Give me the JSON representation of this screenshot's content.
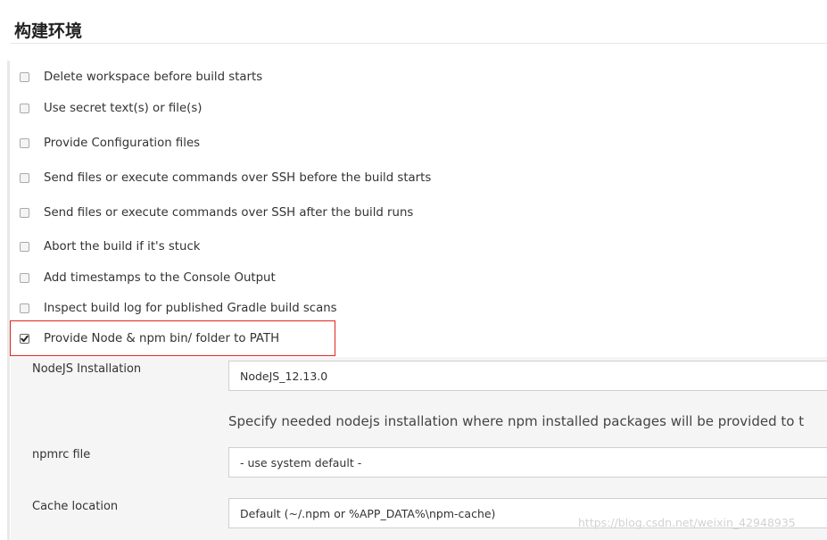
{
  "section": {
    "title": "构建环境"
  },
  "options": [
    {
      "label": "Delete workspace before build starts",
      "checked": false
    },
    {
      "label": "Use secret text(s) or file(s)",
      "checked": false
    },
    {
      "label": "Provide Configuration files",
      "checked": false
    },
    {
      "label": "Send files or execute commands over SSH before the build starts",
      "checked": false
    },
    {
      "label": "Send files or execute commands over SSH after the build runs",
      "checked": false
    },
    {
      "label": "Abort the build if it's stuck",
      "checked": false
    },
    {
      "label": "Add timestamps to the Console Output",
      "checked": false
    },
    {
      "label": "Inspect build log for published Gradle build scans",
      "checked": false
    },
    {
      "label": "Provide Node & npm bin/ folder to PATH",
      "checked": true
    }
  ],
  "node_config": {
    "installation_label": "NodeJS Installation",
    "installation_value": "NodeJS_12.13.0",
    "help_text": "Specify needed nodejs installation where npm installed packages will be provided to t",
    "npmrc_label": "npmrc file",
    "npmrc_value": "- use system default -",
    "cache_label": "Cache location",
    "cache_value": "Default (~/.npm or %APP_DATA%\\npm-cache)"
  },
  "watermark": "https://blog.csdn.net/weixin_42948935",
  "colors": {
    "highlight": "#e0261a",
    "panel_bg": "#f5f5f5"
  }
}
